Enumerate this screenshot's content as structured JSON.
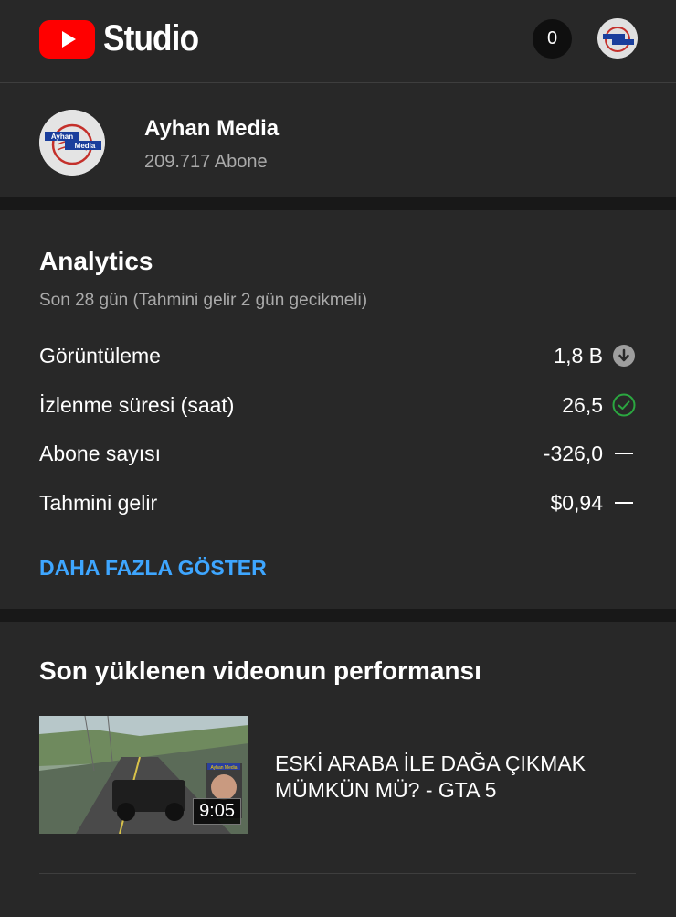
{
  "header": {
    "studio_label": "Studio",
    "notification_count": "0"
  },
  "channel": {
    "name": "Ayhan Media",
    "subscribers": "209.717 Abone",
    "avatar_text_top": "Ayhan",
    "avatar_text_bottom": "Media"
  },
  "analytics": {
    "title": "Analytics",
    "period": "Son 28 gün (Tahmini gelir 2 gün gecikmeli)",
    "rows": [
      {
        "label": "Görüntüleme",
        "value": "1,8 B",
        "indicator": "down-circle-icon"
      },
      {
        "label": "İzlenme süresi (saat)",
        "value": "26,5",
        "indicator": "check-circle-icon"
      },
      {
        "label": "Abone sayısı",
        "value": "-326,0",
        "indicator": "dash-icon"
      },
      {
        "label": "Tahmini gelir",
        "value": "$0,94",
        "indicator": "dash-icon"
      }
    ],
    "more_label": "DAHA FAZLA GÖSTER"
  },
  "recent": {
    "title": "Son yüklenen videonun performansı",
    "video_title": "ESKİ ARABA İLE DAĞA ÇIKMAK MÜMKÜN MÜ? - GTA 5",
    "duration": "9:05",
    "thumb_overlay_text": "Ayhan Media"
  },
  "colors": {
    "background": "#282828",
    "accent_link": "#3ea6ff",
    "brand_red": "#ff0000",
    "check_green": "#2ba640"
  }
}
